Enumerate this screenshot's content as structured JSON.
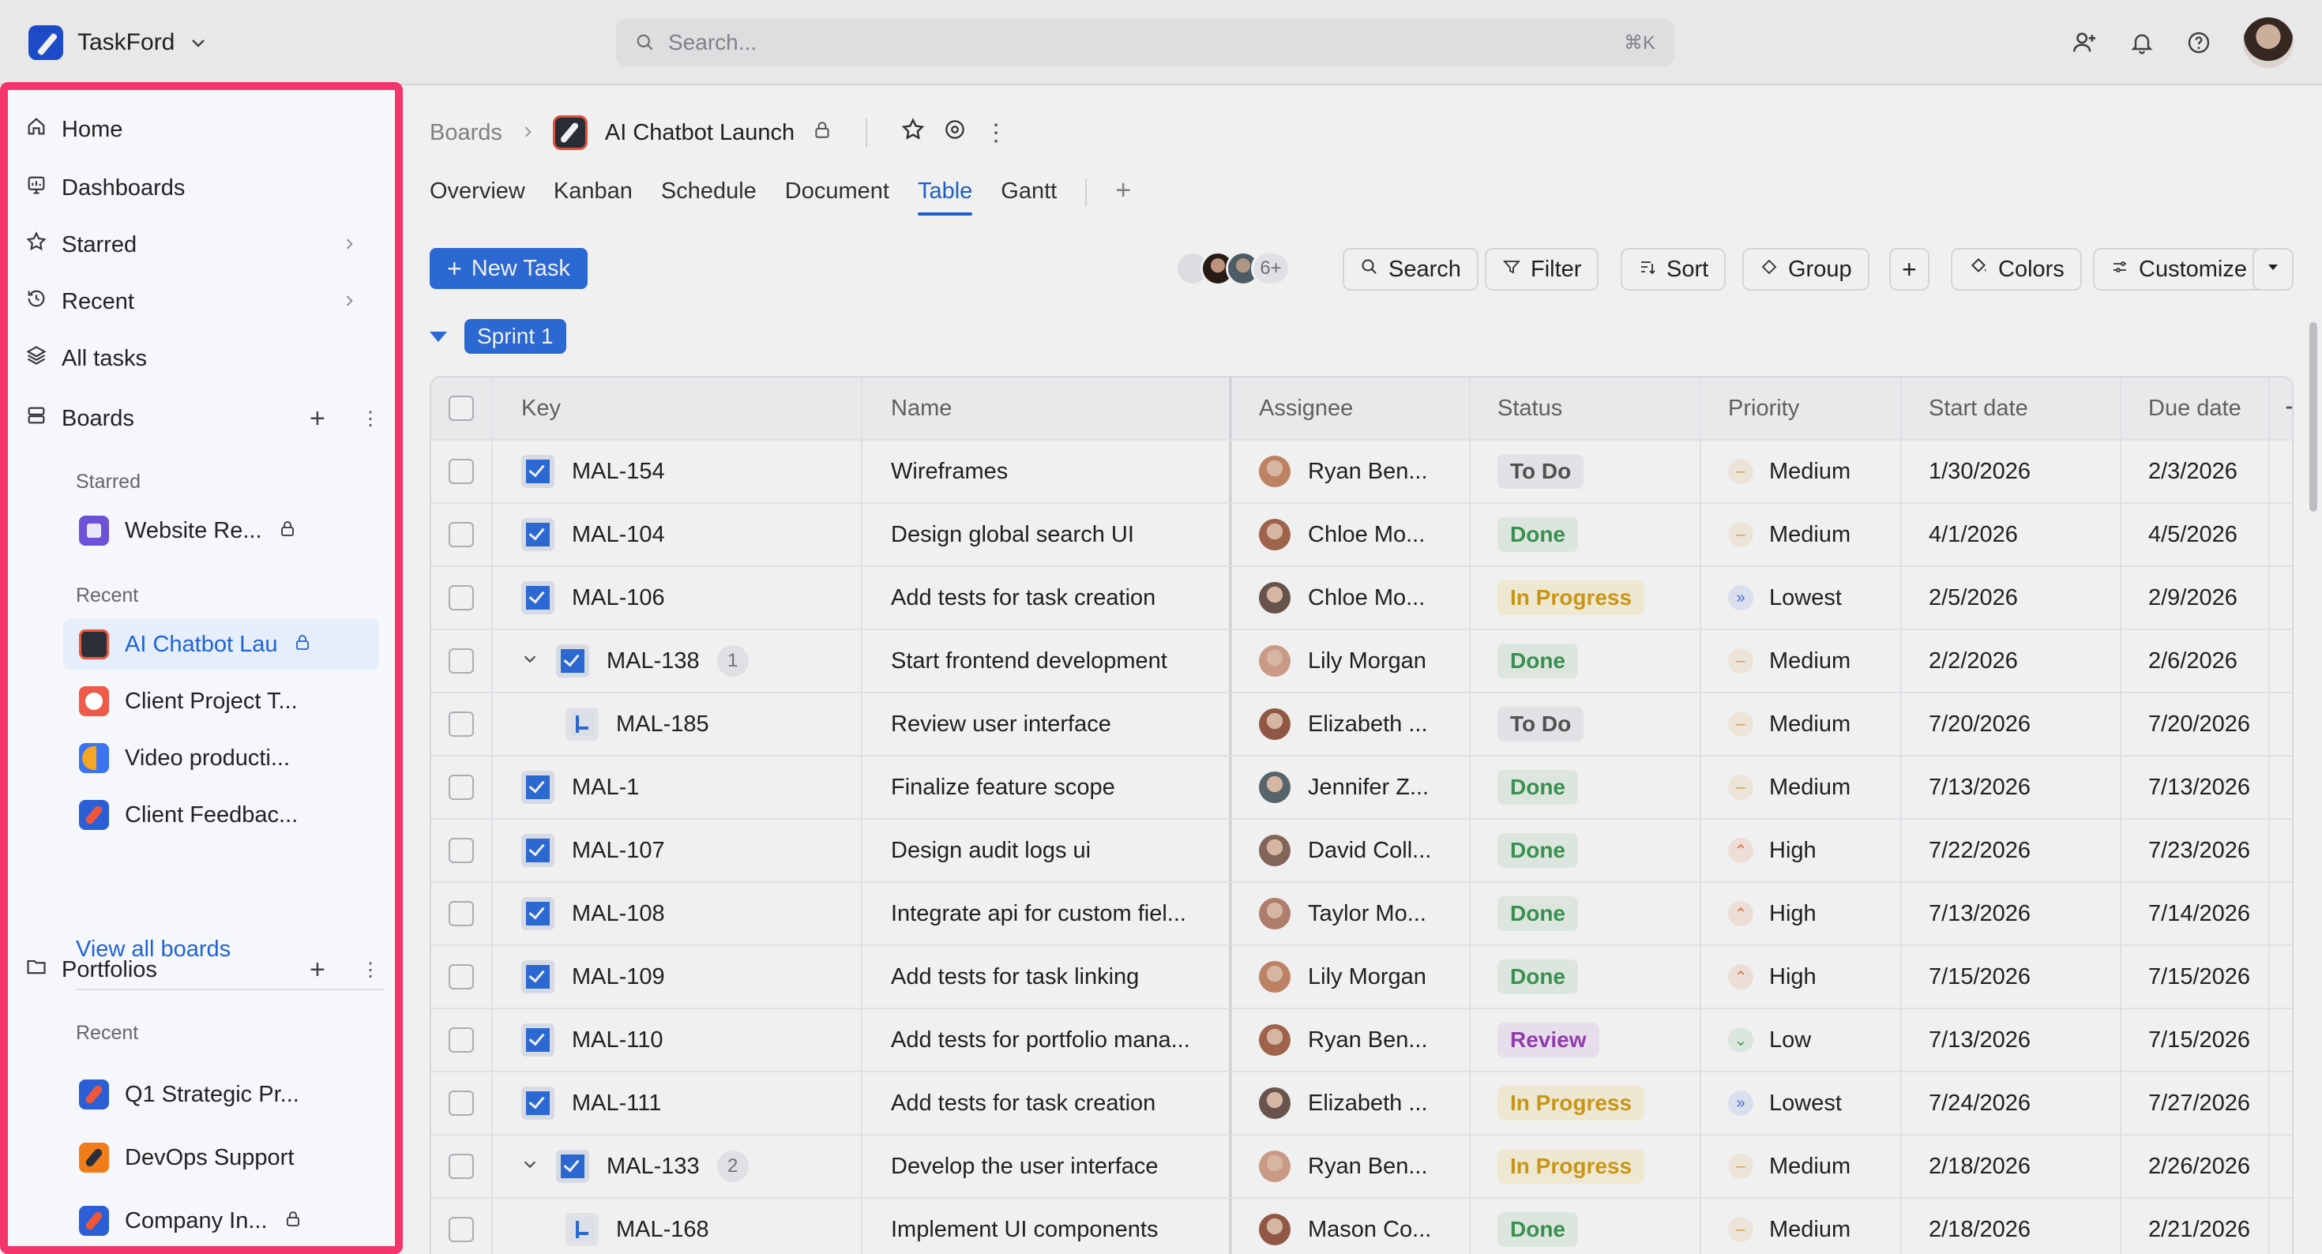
{
  "app": {
    "name": "TaskFord"
  },
  "search": {
    "placeholder": "Search...",
    "shortcut": "⌘K"
  },
  "sidebar": {
    "nav": [
      {
        "label": "Home",
        "icon": "home-icon"
      },
      {
        "label": "Dashboards",
        "icon": "dashboard-icon"
      },
      {
        "label": "Starred",
        "icon": "star-icon"
      },
      {
        "label": "Recent",
        "icon": "history-icon"
      },
      {
        "label": "All tasks",
        "icon": "layers-icon"
      }
    ],
    "boards_label": "Boards",
    "starred_label": "Starred",
    "recent_label": "Recent",
    "starred_boards": [
      {
        "label": "Website Re...",
        "locked": true
      }
    ],
    "recent_boards": [
      {
        "label": "AI Chatbot Lau",
        "locked": true,
        "active": true
      },
      {
        "label": "Client Project T...",
        "locked": false
      },
      {
        "label": "Video producti...",
        "locked": false
      },
      {
        "label": "Client Feedbac...",
        "locked": false
      }
    ],
    "view_all": "View all boards",
    "portfolios_label": "Portfolios",
    "portfolios_recent_label": "Recent",
    "portfolios": [
      {
        "label": "Q1 Strategic Pr...",
        "locked": false
      },
      {
        "label": "DevOps Support",
        "locked": false
      },
      {
        "label": "Company In...",
        "locked": true
      }
    ]
  },
  "breadcrumb": {
    "root": "Boards",
    "title": "AI Chatbot Launch"
  },
  "tabs": [
    "Overview",
    "Kanban",
    "Schedule",
    "Document",
    "Table",
    "Gantt"
  ],
  "active_tab": "Table",
  "toolbar": {
    "new_task": "New Task",
    "more_avatars": "6+",
    "search": "Search",
    "filter": "Filter",
    "sort": "Sort",
    "group": "Group",
    "colors": "Colors",
    "customize": "Customize"
  },
  "sprint": {
    "label": "Sprint 1"
  },
  "table": {
    "headers": {
      "key": "Key",
      "name": "Name",
      "assignee": "Assignee",
      "status": "Status",
      "priority": "Priority",
      "start": "Start date",
      "due": "Due date"
    },
    "rows": [
      {
        "key": "MAL-154",
        "name": "Wireframes",
        "assignee": "Ryan Ben...",
        "status": "To Do",
        "priority": "Medium",
        "start": "1/30/2026",
        "due": "2/3/2026"
      },
      {
        "key": "MAL-104",
        "name": "Design global search UI",
        "assignee": "Chloe Mo...",
        "status": "Done",
        "priority": "Medium",
        "start": "4/1/2026",
        "due": "4/5/2026"
      },
      {
        "key": "MAL-106",
        "name": "Add tests for task creation",
        "assignee": "Chloe Mo...",
        "status": "In Progress",
        "priority": "Lowest",
        "start": "2/5/2026",
        "due": "2/9/2026"
      },
      {
        "key": "MAL-138",
        "name": "Start frontend development",
        "assignee": "Lily Morgan",
        "status": "Done",
        "priority": "Medium",
        "start": "2/2/2026",
        "due": "2/6/2026",
        "subtasks": "1"
      },
      {
        "key": "MAL-185",
        "name": "Review user interface",
        "assignee": "Elizabeth ...",
        "status": "To Do",
        "priority": "Medium",
        "start": "7/20/2026",
        "due": "7/20/2026"
      },
      {
        "key": "MAL-1",
        "name": "Finalize feature scope",
        "assignee": "Jennifer Z...",
        "status": "Done",
        "priority": "Medium",
        "start": "7/13/2026",
        "due": "7/13/2026"
      },
      {
        "key": "MAL-107",
        "name": "Design audit logs ui",
        "assignee": "David Coll...",
        "status": "Done",
        "priority": "High",
        "start": "7/22/2026",
        "due": "7/23/2026"
      },
      {
        "key": "MAL-108",
        "name": "Integrate api for custom fiel...",
        "assignee": "Taylor Mo...",
        "status": "Done",
        "priority": "High",
        "start": "7/13/2026",
        "due": "7/14/2026"
      },
      {
        "key": "MAL-109",
        "name": "Add tests for task linking",
        "assignee": "Lily Morgan",
        "status": "Done",
        "priority": "High",
        "start": "7/15/2026",
        "due": "7/15/2026"
      },
      {
        "key": "MAL-110",
        "name": "Add tests for portfolio mana...",
        "assignee": "Ryan Ben...",
        "status": "Review",
        "priority": "Low",
        "start": "7/13/2026",
        "due": "7/15/2026"
      },
      {
        "key": "MAL-111",
        "name": "Add tests for task creation",
        "assignee": "Elizabeth ...",
        "status": "In Progress",
        "priority": "Lowest",
        "start": "7/24/2026",
        "due": "7/27/2026"
      },
      {
        "key": "MAL-133",
        "name": "Develop the user interface",
        "assignee": "Ryan Ben...",
        "status": "In Progress",
        "priority": "Medium",
        "start": "2/18/2026",
        "due": "2/26/2026",
        "subtasks": "2"
      },
      {
        "key": "MAL-168",
        "name": "Implement UI components",
        "assignee": "Mason Co...",
        "status": "Done",
        "priority": "Medium",
        "start": "2/18/2026",
        "due": "2/21/2026"
      }
    ]
  }
}
